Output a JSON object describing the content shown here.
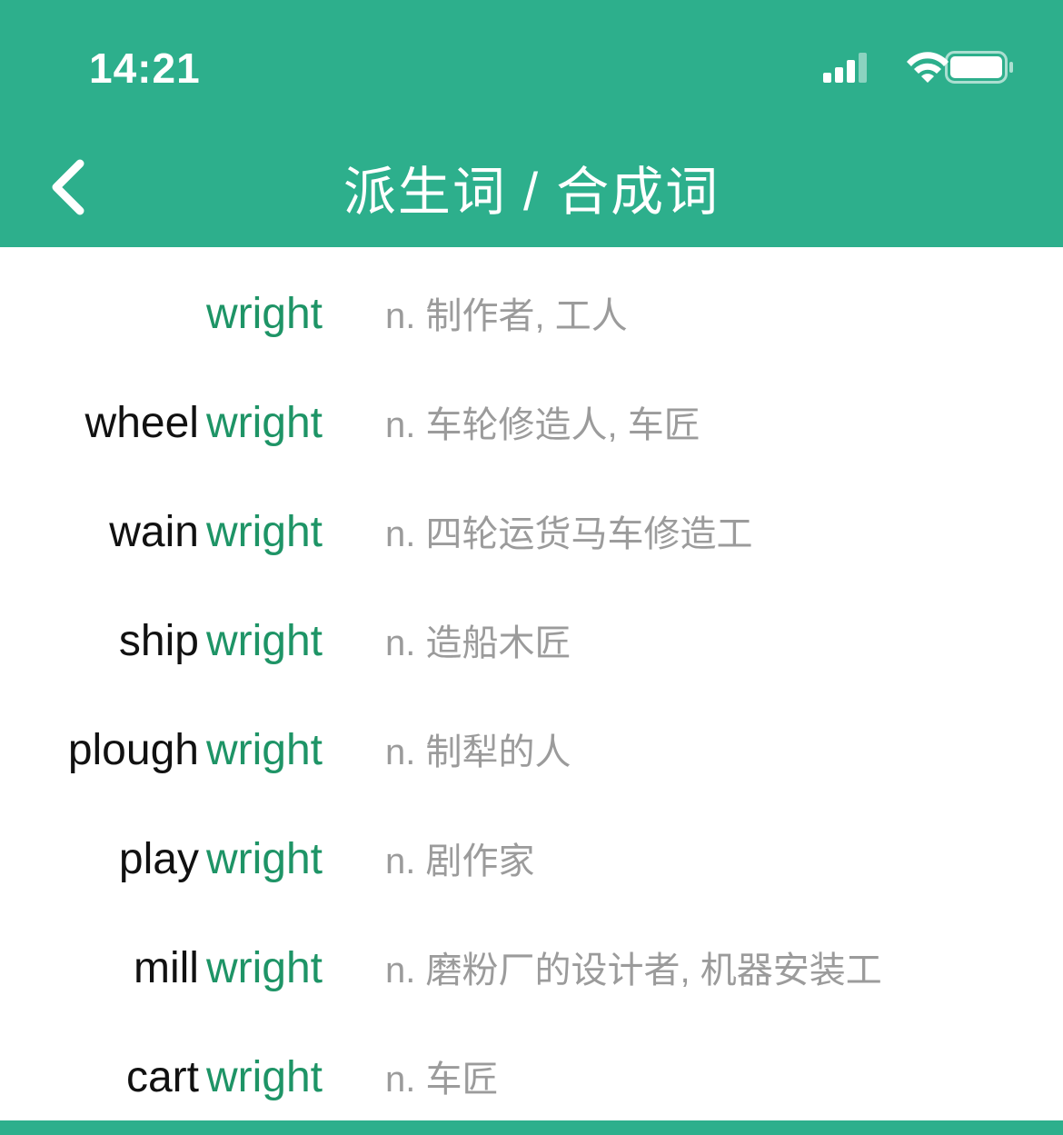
{
  "status_bar": {
    "time": "14:21"
  },
  "nav": {
    "title": "派生词 / 合成词",
    "back_icon": "chevron-left-icon"
  },
  "colors": {
    "header": "#2daf8c",
    "root_word": "#1e9466",
    "prefix": "#111111",
    "meaning": "#9b9b9b"
  },
  "words": [
    {
      "prefix": "",
      "root": "wright",
      "meaning": "n. 制作者, 工人"
    },
    {
      "prefix": "wheel",
      "root": "wright",
      "meaning": "n. 车轮修造人, 车匠"
    },
    {
      "prefix": "wain",
      "root": "wright",
      "meaning": "n. 四轮运货马车修造工"
    },
    {
      "prefix": "ship",
      "root": "wright",
      "meaning": "n. 造船木匠"
    },
    {
      "prefix": "plough",
      "root": "wright",
      "meaning": "n. 制犁的人"
    },
    {
      "prefix": "play",
      "root": "wright",
      "meaning": "n. 剧作家"
    },
    {
      "prefix": "mill",
      "root": "wright",
      "meaning": "n. 磨粉厂的设计者, 机器安装工"
    },
    {
      "prefix": "cart",
      "root": "wright",
      "meaning": "n. 车匠"
    }
  ]
}
